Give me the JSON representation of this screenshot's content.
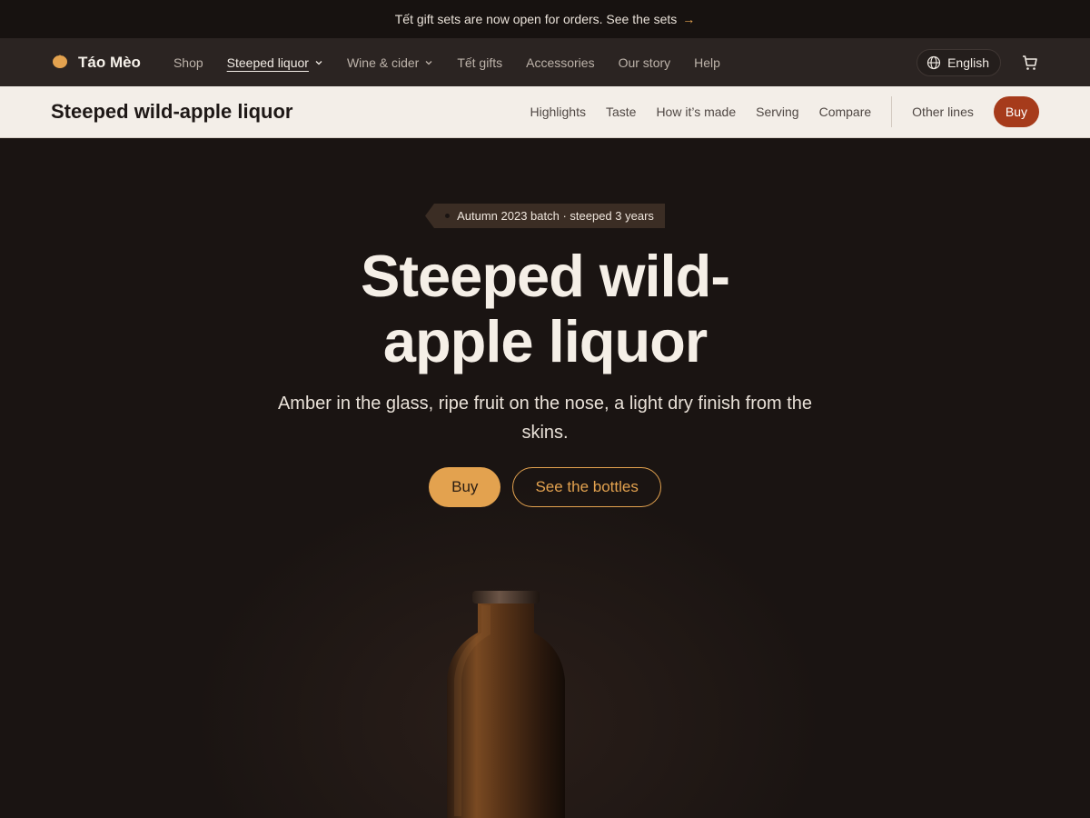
{
  "announcement": {
    "text": "Tết gift sets are now open for orders. See the sets",
    "arrow": "→"
  },
  "globalnav": {
    "brand": "Táo Mèo",
    "links": [
      "Shop",
      "Steeped liquor",
      "Wine & cider",
      "Tết gifts",
      "Accessories",
      "Our story",
      "Help"
    ],
    "active_link": "Steeped liquor",
    "language": "English"
  },
  "localnav": {
    "title": "Steeped wild-apple liquor",
    "links": [
      "Highlights",
      "Taste",
      "How it’s made",
      "Serving",
      "Compare"
    ],
    "other": "Other lines",
    "buy": "Buy"
  },
  "hero": {
    "tag": "Autumn 2023 batch · steeped 3 years",
    "title_line1": "Steeped wild-",
    "title_line2": "apple liquor",
    "subtitle": "Amber in the glass, ripe fruit on the nose, a light dry finish from the skins.",
    "cta_primary": "Buy",
    "cta_secondary": "See the bottles"
  },
  "colors": {
    "accent": "#e3a24f",
    "buy_red": "#a63b1b",
    "background": "#1a1412"
  }
}
